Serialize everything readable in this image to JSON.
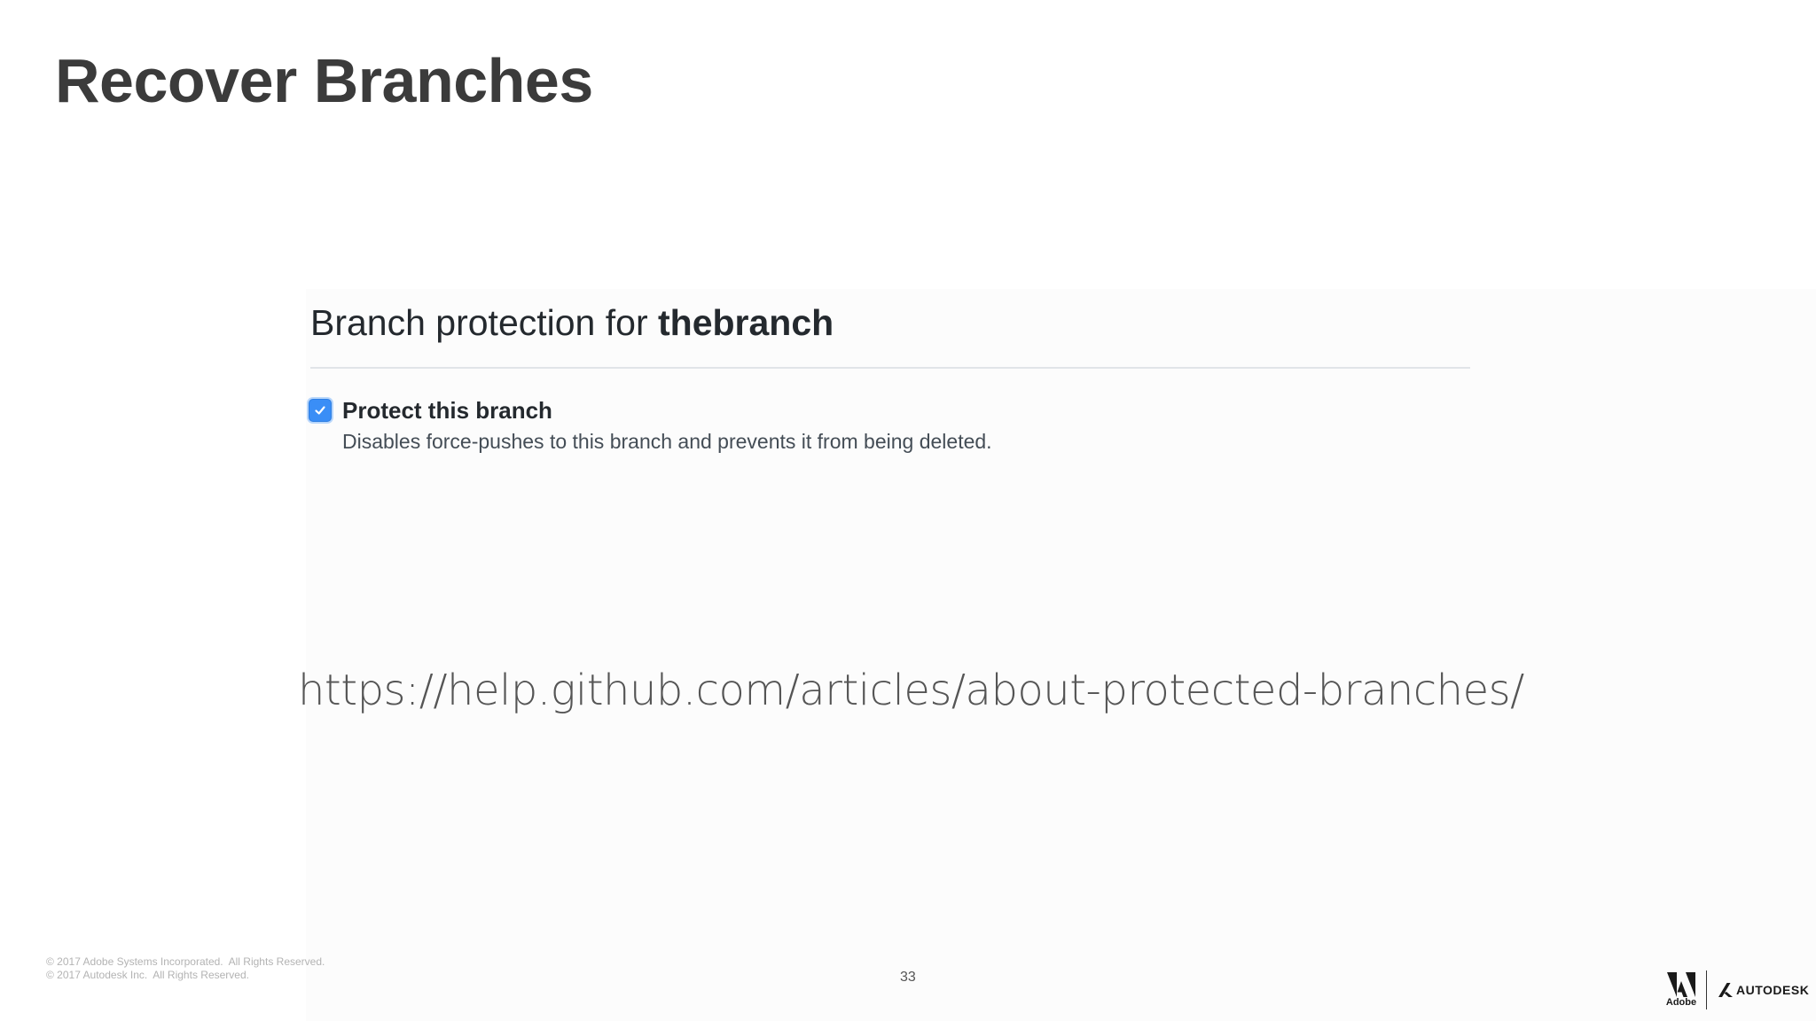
{
  "slide": {
    "title": "Recover Branches",
    "page_number": "33",
    "help_url": "https://help.github.com/articles/about-protected-branches/"
  },
  "branch_protection": {
    "heading_prefix": "Branch protection for",
    "branch_name": "thebranch",
    "protect_checkbox": {
      "checked": true,
      "label": "Protect this branch",
      "description": "Disables force-pushes to this branch and prevents it from being deleted."
    }
  },
  "footer": {
    "copyright_lines": [
      "© 2017 Adobe Systems Incorporated.  All Rights Reserved.",
      "© 2017 Autodesk Inc.  All Rights Reserved."
    ],
    "logos": {
      "adobe_text": "Adobe",
      "autodesk_text": "AUTODESK"
    }
  },
  "colors": {
    "title": "#3b3b3b",
    "checkbox_accent": "#3a8ef6",
    "url_text": "#555555"
  },
  "icons": {
    "checkbox": "checkmark-icon",
    "adobe": "adobe-logo-icon",
    "autodesk": "autodesk-logo-icon"
  }
}
